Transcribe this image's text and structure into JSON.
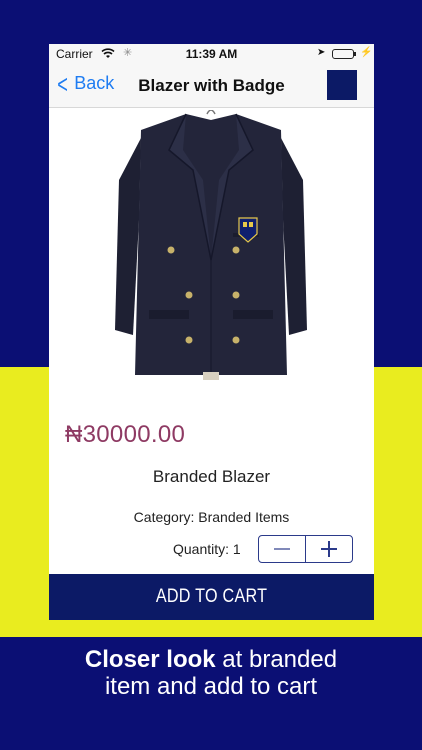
{
  "status_bar": {
    "carrier": "Carrier",
    "time": "11:39 AM"
  },
  "nav": {
    "back_label": "Back",
    "title": "Blazer with Badge"
  },
  "product": {
    "price": "₦30000.00",
    "name": "Branded Blazer",
    "category": "Category: Branded Items",
    "quantity_label": "Quantity: 1"
  },
  "cart": {
    "button_label": "ADD TO CART"
  },
  "caption": {
    "bold": "Closer look",
    "line1_rest": " at branded",
    "line2": "item and add to cart"
  },
  "colors": {
    "background_blue": "#0b0f74",
    "accent_yellow": "#e9ec1f",
    "navy": "#0c1a66",
    "price": "#8e3a63",
    "link_blue": "#1e7cf2"
  }
}
